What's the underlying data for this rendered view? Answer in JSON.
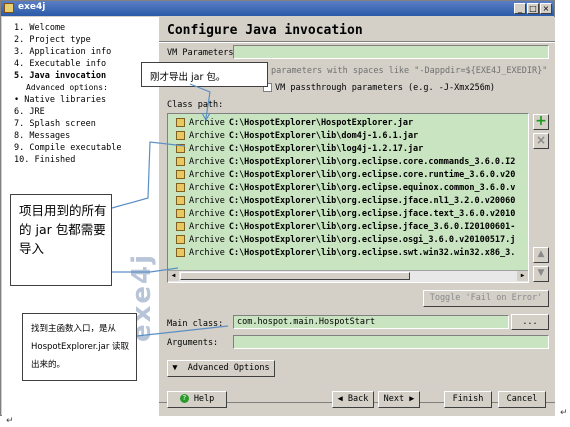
{
  "window": {
    "title": "exe4j"
  },
  "steps": [
    {
      "label": "1.  Welcome"
    },
    {
      "label": "2.  Project type"
    },
    {
      "label": "3.  Application info"
    },
    {
      "label": "4.  Executable info"
    },
    {
      "label": "5.  Java invocation"
    },
    {
      "label": "Advanced options:"
    },
    {
      "label": "• Native libraries"
    },
    {
      "label": "6.  JRE"
    },
    {
      "label": "7.  Splash screen"
    },
    {
      "label": "8.  Messages"
    },
    {
      "label": "9.  Compile executable"
    },
    {
      "label": "10. Finished"
    }
  ],
  "brand": "exe4j",
  "main": {
    "heading": "Configure Java invocation",
    "vm_label": "VM Parameters:",
    "vm_hint": "parameters with spaces like \"-Dappdir=${EXE4J_EXEDIR}\"",
    "passthrough_label": "VM passthrough parameters (e.g. -J-Xmx256m)",
    "classpath_label": "Class path:",
    "classpath": [
      {
        "kind": "Archive",
        "path": "C:\\HospotExplorer\\HospotExplorer.jar"
      },
      {
        "kind": "Archive",
        "path": "C:\\HospotExplorer\\lib\\dom4j-1.6.1.jar"
      },
      {
        "kind": "Archive",
        "path": "C:\\HospotExplorer\\lib\\log4j-1.2.17.jar"
      },
      {
        "kind": "Archive",
        "path": "C:\\HospotExplorer\\lib\\org.eclipse.core.commands_3.6.0.I2"
      },
      {
        "kind": "Archive",
        "path": "C:\\HospotExplorer\\lib\\org.eclipse.core.runtime_3.6.0.v20"
      },
      {
        "kind": "Archive",
        "path": "C:\\HospotExplorer\\lib\\org.eclipse.equinox.common_3.6.0.v"
      },
      {
        "kind": "Archive",
        "path": "C:\\HospotExplorer\\lib\\org.eclipse.jface.nl1_3.2.0.v20060"
      },
      {
        "kind": "Archive",
        "path": "C:\\HospotExplorer\\lib\\org.eclipse.jface.text_3.6.0.v2010"
      },
      {
        "kind": "Archive",
        "path": "C:\\HospotExplorer\\lib\\org.eclipse.jface_3.6.0.I20100601-"
      },
      {
        "kind": "Archive",
        "path": "C:\\HospotExplorer\\lib\\org.eclipse.osgi_3.6.0.v20100517.j"
      },
      {
        "kind": "Archive",
        "path": "C:\\HospotExplorer\\lib\\org.eclipse.swt.win32.win32.x86_3."
      }
    ],
    "toggle_label": "Toggle 'Fail on Error'",
    "main_class_label": "Main class:",
    "main_class_value": "com.hospot.main.HospotStart",
    "browse_label": "...",
    "arguments_label": "Arguments:",
    "advanced_label": "Advanced Options"
  },
  "footer": {
    "help": "Help",
    "back": "Back",
    "next": "Next",
    "finish": "Finish",
    "cancel": "Cancel"
  },
  "annotations": {
    "top": "刚才导出 jar 包。",
    "middle": "项目用到的所有的 jar 包都需要导入",
    "bottom": "找到主函数入口，是从 HospotExplorer.jar 读取出来的。"
  },
  "colors": {
    "field_bg": "#c8e4c0",
    "window_bg": "#d4d0c8",
    "title_bar": "#2a5aa8"
  }
}
